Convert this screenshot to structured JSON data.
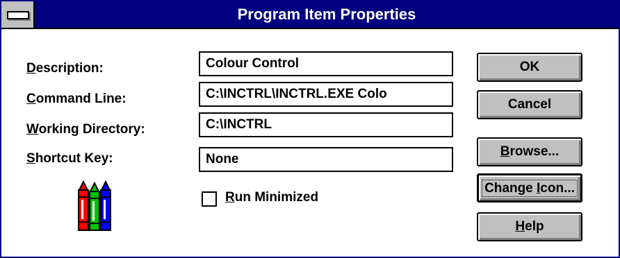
{
  "window": {
    "title": "Program Item Properties"
  },
  "form": {
    "description": {
      "label": "Description:",
      "value": "Colour Control"
    },
    "command_line": {
      "label": "Command Line:",
      "value": "C:\\INCTRL\\INCTRL.EXE Colo"
    },
    "working_directory": {
      "label": "Working Directory:",
      "value": "C:\\INCTRL"
    },
    "shortcut_key": {
      "label": "Shortcut Key:",
      "value": "None"
    },
    "run_minimized": {
      "label": "Run Minimized",
      "checked": false
    }
  },
  "buttons": {
    "ok": "OK",
    "cancel": "Cancel",
    "browse": "Browse...",
    "change_icon": "Change Icon...",
    "help": "Help"
  },
  "icons": {
    "system_menu": "system-menu-icon",
    "program": "crayons-icon"
  },
  "colors": {
    "title_bar": "#000080",
    "button_face": "#c0c0c0",
    "crayon_red": "#ff0000",
    "crayon_green": "#00c000",
    "crayon_blue": "#0000ff"
  }
}
